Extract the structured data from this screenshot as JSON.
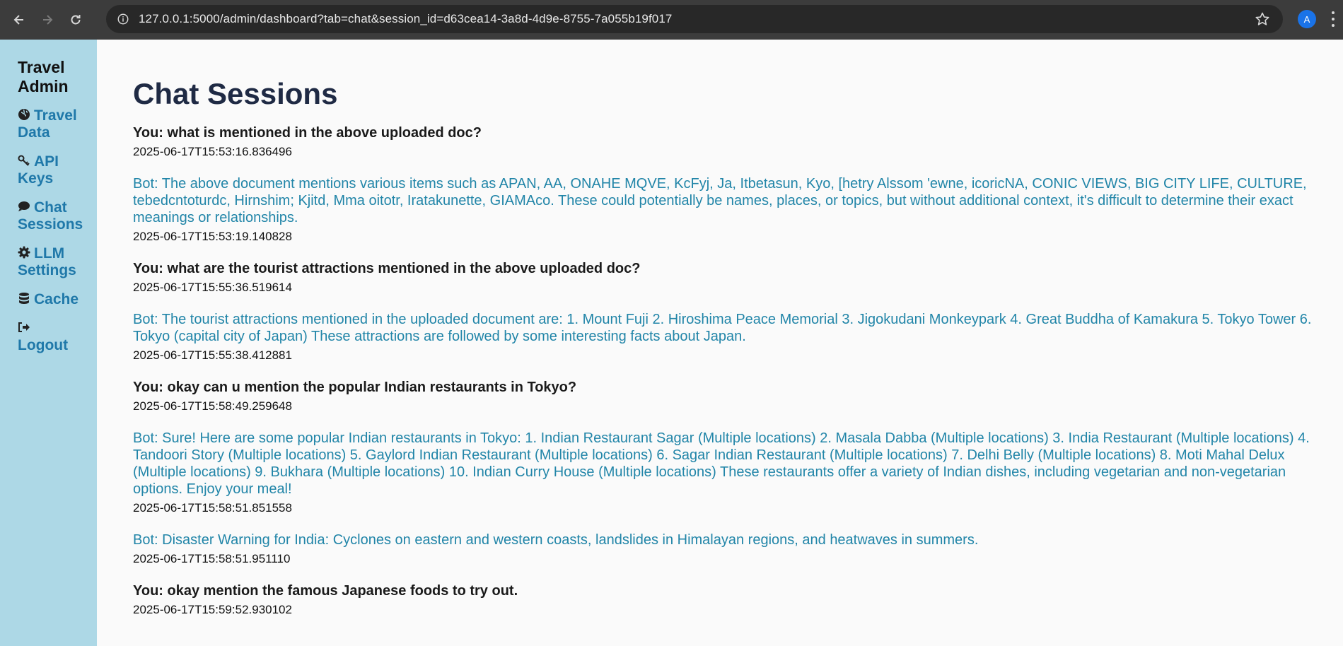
{
  "browser": {
    "url": "127.0.0.1:5000/admin/dashboard?tab=chat&session_id=d63cea14-3a8d-4d9e-8755-7a055b19f017",
    "profile_initial": "A"
  },
  "sidebar": {
    "brand": "Travel Admin",
    "items": [
      {
        "icon": "globe-icon",
        "label": "Travel Data"
      },
      {
        "icon": "key-icon",
        "label": "API Keys"
      },
      {
        "icon": "chat-bubble-icon",
        "label": "Chat Sessions"
      },
      {
        "icon": "gear-icon",
        "label": "LLM Settings"
      },
      {
        "icon": "database-icon",
        "label": "Cache"
      },
      {
        "icon": "sign-out-icon",
        "label": "Logout"
      }
    ]
  },
  "main": {
    "title": "Chat Sessions",
    "messages": [
      {
        "role": "user",
        "text": "You: what is mentioned in the above uploaded doc?",
        "timestamp": "2025-06-17T15:53:16.836496"
      },
      {
        "role": "bot",
        "text": "Bot: The above document mentions various items such as APAN, AA, ONAHE MQVE, KcFyj, Ja, Itbetasun, Kyo, [hetry Alssom 'ewne, icoricNA, CONIC VIEWS, BIG CITY LIFE, CULTURE, tebedcntoturdc, Hirnshim; Kjitd, Mma oitotr, Iratakunette, GIAMAco. These could potentially be names, places, or topics, but without additional context, it's difficult to determine their exact meanings or relationships.",
        "timestamp": "2025-06-17T15:53:19.140828"
      },
      {
        "role": "user",
        "text": "You: what are the tourist attractions mentioned in the above uploaded doc?",
        "timestamp": "2025-06-17T15:55:36.519614"
      },
      {
        "role": "bot",
        "text": "Bot: The tourist attractions mentioned in the uploaded document are: 1. Mount Fuji 2. Hiroshima Peace Memorial 3. Jigokudani Monkeypark 4. Great Buddha of Kamakura 5. Tokyo Tower 6. Tokyo (capital city of Japan) These attractions are followed by some interesting facts about Japan.",
        "timestamp": "2025-06-17T15:55:38.412881"
      },
      {
        "role": "user",
        "text": "You: okay can u mention the popular Indian restaurants in Tokyo?",
        "timestamp": "2025-06-17T15:58:49.259648"
      },
      {
        "role": "bot",
        "text": "Bot: Sure! Here are some popular Indian restaurants in Tokyo: 1. Indian Restaurant Sagar (Multiple locations) 2. Masala Dabba (Multiple locations) 3. India Restaurant (Multiple locations) 4. Tandoori Story (Multiple locations) 5. Gaylord Indian Restaurant (Multiple locations) 6. Sagar Indian Restaurant (Multiple locations) 7. Delhi Belly (Multiple locations) 8. Moti Mahal Delux (Multiple locations) 9. Bukhara (Multiple locations) 10. Indian Curry House (Multiple locations) These restaurants offer a variety of Indian dishes, including vegetarian and non-vegetarian options. Enjoy your meal!",
        "timestamp": "2025-06-17T15:58:51.851558"
      },
      {
        "role": "bot",
        "text": "Bot: Disaster Warning for India: Cyclones on eastern and western coasts, landslides in Himalayan regions, and heatwaves in summers.",
        "timestamp": "2025-06-17T15:58:51.951110"
      },
      {
        "role": "user",
        "text": "You: okay mention the famous Japanese foods to try out.",
        "timestamp": "2025-06-17T15:59:52.930102"
      }
    ]
  },
  "colors": {
    "sidebar_bg": "#add8e6",
    "link": "#1f78a9",
    "bot_text": "#2185a8",
    "title": "#1f2a44"
  }
}
